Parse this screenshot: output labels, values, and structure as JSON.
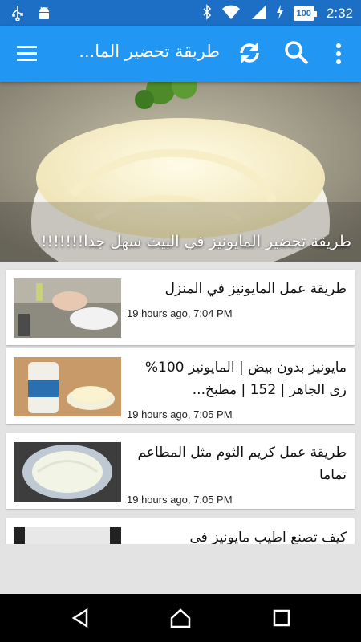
{
  "status": {
    "time": "2:32",
    "battery": "100"
  },
  "app_bar": {
    "title": "طريقة تحضير الما..."
  },
  "hero": {
    "title": "طريقة تحضير المايونيز في البيت سهل جدا!!!!!!!"
  },
  "articles": [
    {
      "title": "طريقة عمل المايونيز في المنزل",
      "time": "19 hours ago, 7:04 PM"
    },
    {
      "title": "مايونيز بدون بيض | المايونيز 100% زى الجاهز | 152 | مطبخ...",
      "time": "19 hours ago, 7:05 PM"
    },
    {
      "title": "طريقة عمل كريم الثوم مثل المطاعم تماما",
      "time": "19 hours ago, 7:05 PM"
    },
    {
      "title": "كيف تصنع اطيب مايونيز في",
      "time": ""
    }
  ],
  "colors": {
    "status_bar": "#1c6fc4",
    "app_bar": "#2196f3",
    "background": "#e3e3e3",
    "nav_bar": "#000000"
  }
}
